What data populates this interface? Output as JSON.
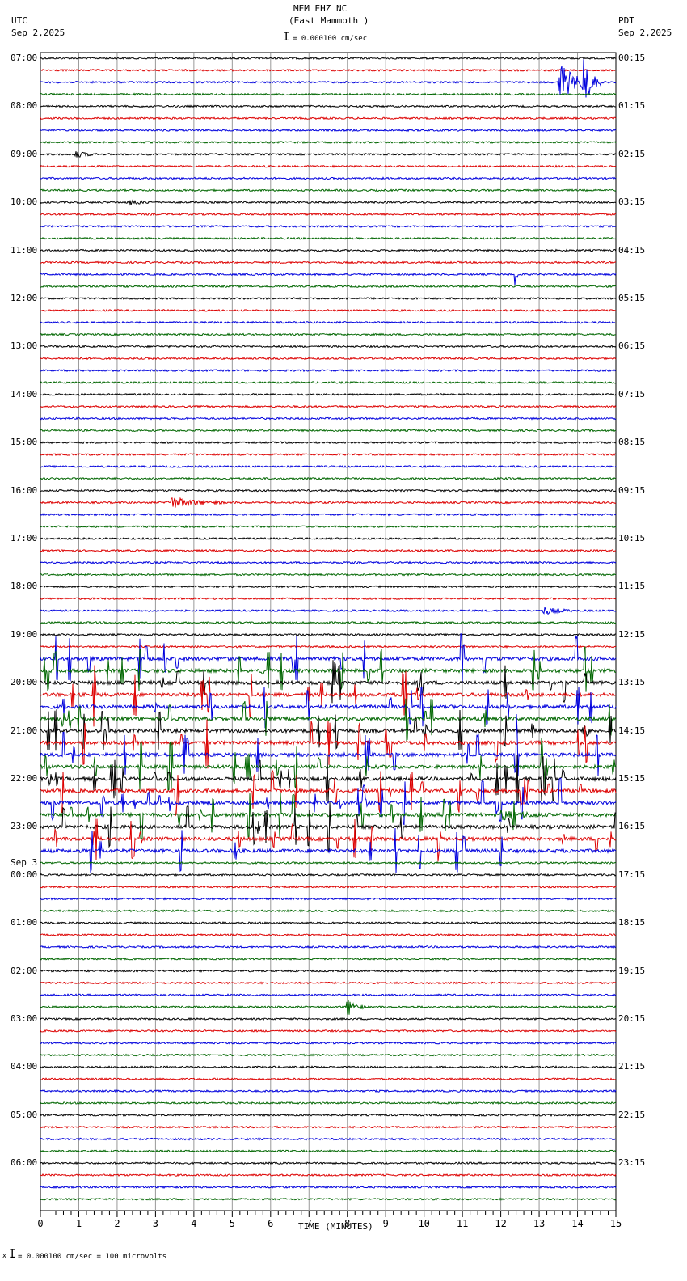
{
  "header": {
    "title": "MEM EHZ NC",
    "subtitle": "(East Mammoth )",
    "left_tz": "UTC",
    "left_date": "Sep 2,2025",
    "right_tz": "PDT",
    "right_date": "Sep 2,2025",
    "scale": "= 0.000100 cm/sec"
  },
  "footer": {
    "scale": "= 0.000100 cm/sec =     100 microvolts",
    "mark": "x"
  },
  "chart_data": {
    "type": "line",
    "xlabel": "TIME (MINUTES)",
    "xlim": [
      0,
      15
    ],
    "xticks": [
      "0",
      "1",
      "2",
      "3",
      "4",
      "5",
      "6",
      "7",
      "8",
      "9",
      "10",
      "11",
      "12",
      "13",
      "14",
      "15"
    ],
    "left_labels": [
      "07:00",
      "08:00",
      "09:00",
      "10:00",
      "11:00",
      "12:00",
      "13:00",
      "14:00",
      "15:00",
      "16:00",
      "17:00",
      "18:00",
      "19:00",
      "20:00",
      "21:00",
      "22:00",
      "23:00",
      "00:00",
      "01:00",
      "02:00",
      "03:00",
      "04:00",
      "05:00",
      "06:00"
    ],
    "date_change_label": "Sep 3",
    "right_labels": [
      "00:15",
      "01:15",
      "02:15",
      "03:15",
      "04:15",
      "05:15",
      "06:15",
      "07:15",
      "08:15",
      "09:15",
      "10:15",
      "11:15",
      "12:15",
      "13:15",
      "14:15",
      "15:15",
      "16:15",
      "17:15",
      "18:15",
      "19:15",
      "20:15",
      "21:15",
      "22:15",
      "23:15"
    ],
    "trace_count": 96,
    "trace_colors": [
      "#000000",
      "#dd0000",
      "#0000dd",
      "#006600"
    ],
    "swarm_traces": [
      50,
      51,
      52,
      53,
      54,
      55,
      56,
      57,
      58,
      59,
      60,
      61,
      62,
      63,
      64,
      65,
      66
    ],
    "events": [
      {
        "trace": 2,
        "minute": 13.5,
        "amp": 30,
        "dur": 0.8
      },
      {
        "trace": 2,
        "minute": 14.1,
        "amp": 40,
        "dur": 0.5
      },
      {
        "trace": 18,
        "minute": 12.35,
        "amp": 30,
        "dur": 0.1
      },
      {
        "trace": 37,
        "minute": 3.3,
        "amp": 8,
        "dur": 1.5
      },
      {
        "trace": 79,
        "minute": 7.95,
        "amp": 14,
        "dur": 0.5
      },
      {
        "trace": 8,
        "minute": 0.9,
        "amp": 4,
        "dur": 0.6
      },
      {
        "trace": 12,
        "minute": 2.3,
        "amp": 4,
        "dur": 0.6
      },
      {
        "trace": 46,
        "minute": 13.1,
        "amp": 5,
        "dur": 0.8
      },
      {
        "trace": 63,
        "minute": 12.0,
        "amp": 6,
        "dur": 1.2
      }
    ]
  }
}
